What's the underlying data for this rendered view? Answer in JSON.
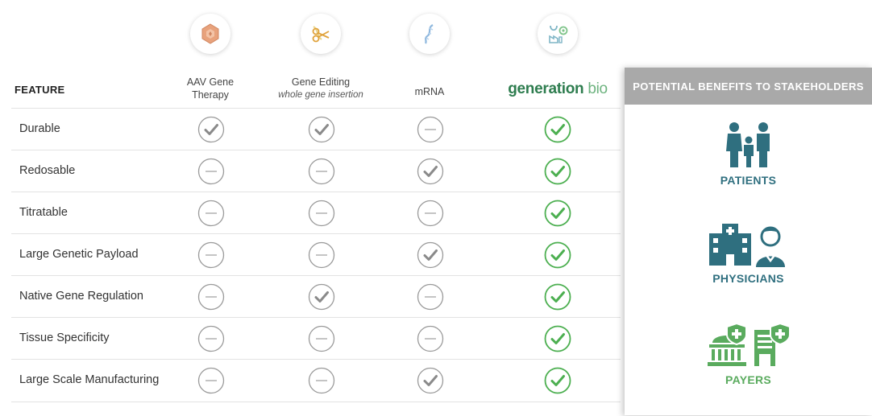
{
  "header": {
    "feature_label": "FEATURE",
    "columns": [
      {
        "line1": "AAV Gene",
        "line2": "Therapy",
        "icon": "aav-capsid-icon"
      },
      {
        "line1": "Gene Editing",
        "line2": "whole gene insertion",
        "icon": "gene-scissors-icon"
      },
      {
        "line1": "mRNA",
        "line2": "",
        "icon": "mrna-strand-icon"
      },
      {
        "brand_main": "generation",
        "brand_suffix": "bio",
        "icon": "manufacturing-icon"
      }
    ]
  },
  "rows": [
    {
      "label": "Durable",
      "marks": [
        "check",
        "check",
        "dash",
        "green-check"
      ]
    },
    {
      "label": "Redosable",
      "marks": [
        "dash",
        "dash",
        "check",
        "green-check"
      ]
    },
    {
      "label": "Titratable",
      "marks": [
        "dash",
        "dash",
        "dash",
        "green-check"
      ]
    },
    {
      "label": "Large Genetic Payload",
      "marks": [
        "dash",
        "dash",
        "check",
        "green-check"
      ]
    },
    {
      "label": "Native Gene Regulation",
      "marks": [
        "dash",
        "check",
        "dash",
        "green-check"
      ]
    },
    {
      "label": "Tissue Specificity",
      "marks": [
        "dash",
        "dash",
        "dash",
        "green-check"
      ]
    },
    {
      "label": "Large Scale Manufacturing",
      "marks": [
        "dash",
        "dash",
        "check",
        "green-check"
      ]
    }
  ],
  "panel": {
    "title": "POTENTIAL BENEFITS TO STAKEHOLDERS",
    "stakeholders": [
      {
        "label": "PATIENTS",
        "color": "#2f6f7f",
        "icon": "family-icon"
      },
      {
        "label": "PHYSICIANS",
        "color": "#2f6f7f",
        "icon": "hospital-doctor-icon"
      },
      {
        "label": "PAYERS",
        "color": "#5aab5e",
        "icon": "government-shield-icon"
      }
    ]
  },
  "colors": {
    "gray_mark": "#9a9a9a",
    "green_mark": "#4caf50",
    "brand_green": "#2e7d4f",
    "teal": "#2f6f7f",
    "payer_green": "#5aab5e",
    "panel_header": "#a9a9a9"
  }
}
